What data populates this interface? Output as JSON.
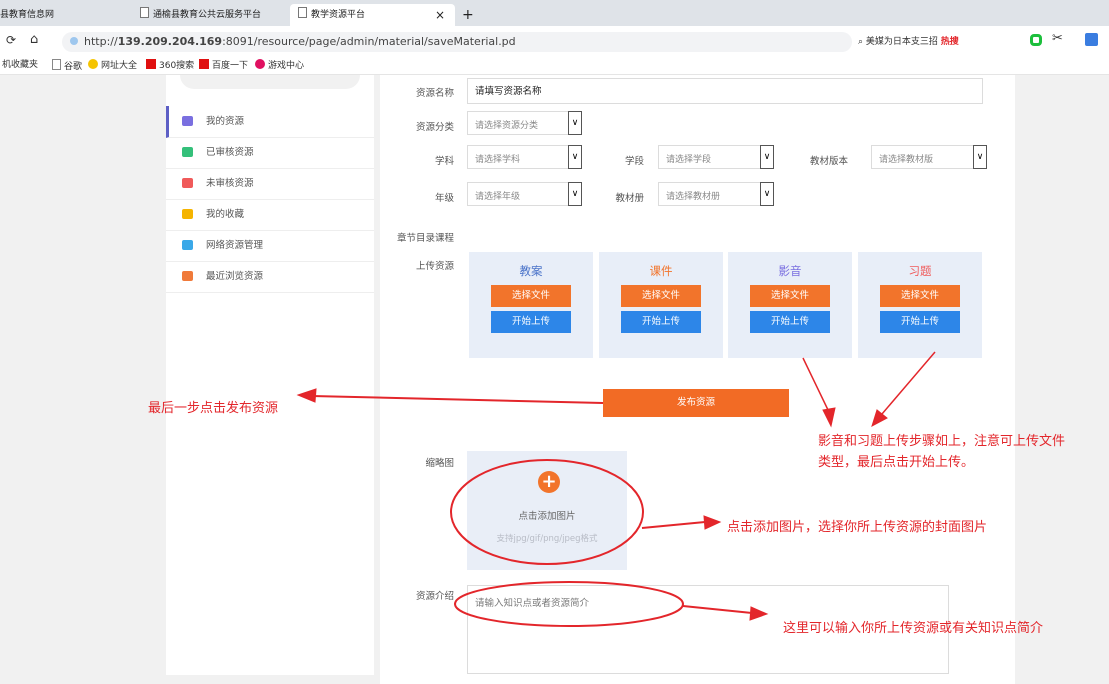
{
  "browser": {
    "tabs": [
      "县教育信息网",
      "通榆县教育公共云服务平台",
      "教学资源平台"
    ],
    "new_tab": "+",
    "close_tab": "×",
    "url_prefix": "http://",
    "url_host": "139.209.204.169",
    "url_rest": ":8091/resource/page/admin/material/saveMaterial.pd",
    "search_text": "美媒为日本支三招",
    "hot_label": "热搜",
    "bookmarks": [
      "机收藏夹",
      "谷歌",
      "网址大全",
      "360搜索",
      "百度一下",
      "游戏中心"
    ]
  },
  "sidebar": {
    "items": [
      {
        "label": "我的资源",
        "color": "#7a6fe0"
      },
      {
        "label": "已审核资源",
        "color": "#34c07a"
      },
      {
        "label": "未审核资源",
        "color": "#f05a5a"
      },
      {
        "label": "我的收藏",
        "color": "#f5b400"
      },
      {
        "label": "网络资源管理",
        "color": "#3aa8e8"
      },
      {
        "label": "最近浏览资源",
        "color": "#f07a3a"
      }
    ]
  },
  "form": {
    "name_label": "资源名称",
    "name_value": "请填写资源名称",
    "category_label": "资源分类",
    "category_placeholder": "请选择资源分类",
    "subject_label": "学科",
    "subject_placeholder": "请选择学科",
    "stage_label": "学段",
    "stage_placeholder": "请选择学段",
    "edition_label": "教材版本",
    "edition_placeholder": "请选择教材版",
    "grade_label": "年级",
    "grade_placeholder": "请选择年级",
    "volume_label": "教材册",
    "volume_placeholder": "请选择教材册",
    "chapter_label": "章节目录课程",
    "upload_label": "上传资源",
    "caret": "∨"
  },
  "upload": {
    "choose_label": "选择文件",
    "start_label": "开始上传",
    "boxes": [
      {
        "title": "教案",
        "color": "#4a73c9"
      },
      {
        "title": "课件",
        "color": "#f2742b"
      },
      {
        "title": "影音",
        "color": "#7a6fe0"
      },
      {
        "title": "习题",
        "color": "#f05a5a"
      }
    ]
  },
  "publish_label": "发布资源",
  "thumbnail": {
    "label": "缩略图",
    "plus": "+",
    "add_text": "点击添加图片",
    "hint": "支持jpg/gif/png/jpeg格式"
  },
  "intro": {
    "label": "资源介绍",
    "placeholder": "请输入知识点或者资源简介"
  },
  "annotations": {
    "publish": "最后一步点击发布资源",
    "media_line1": "影音和习题上传步骤如上，注意可上传文件",
    "media_line2": "类型，最后点击开始上传。",
    "thumb": "点击添加图片，选择你所上传资源的封面图片",
    "intro": "这里可以输入你所上传资源或有关知识点简介"
  },
  "colors": {
    "orange": "#f2742b",
    "blue": "#2d86e8",
    "annotation_red": "#e3262b"
  }
}
